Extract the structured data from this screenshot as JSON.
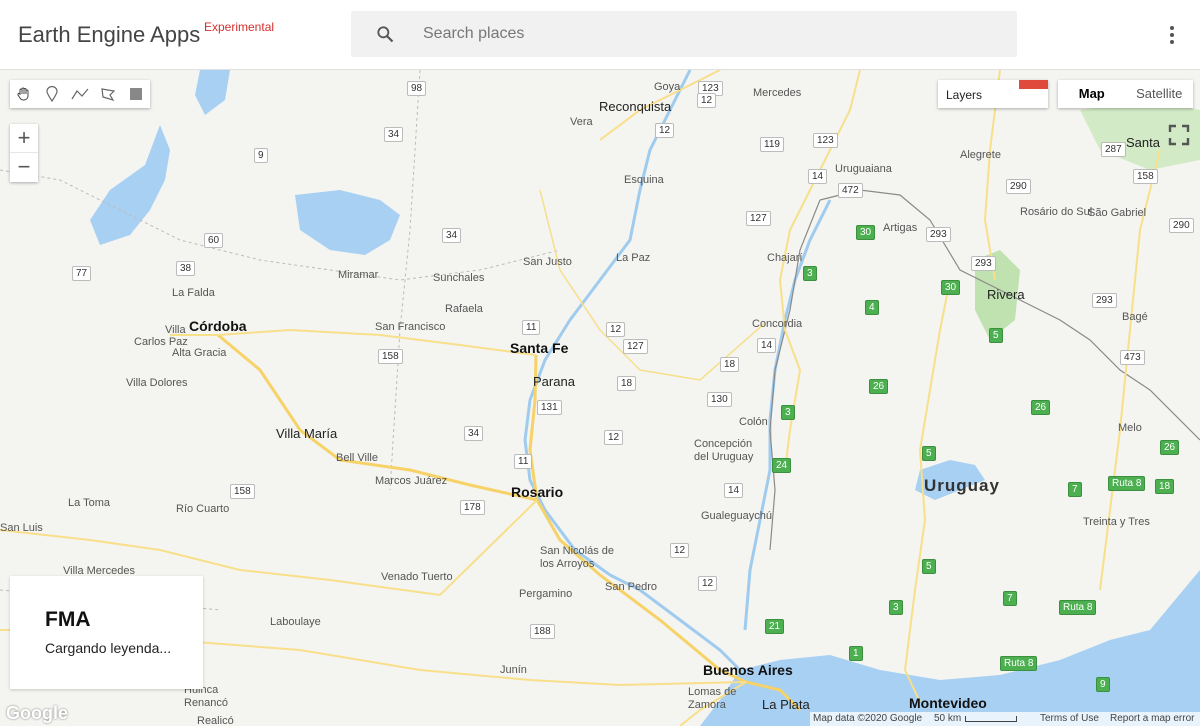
{
  "header": {
    "app_title": "Earth Engine Apps",
    "badge": "Experimental",
    "search_placeholder": "Search places"
  },
  "controls": {
    "zoom_in": "+",
    "zoom_out": "−",
    "layers_label": "Layers",
    "map_type": [
      "Map",
      "Satellite"
    ],
    "map_type_selected": "Map",
    "draw_tools": [
      "hand-icon",
      "point-icon",
      "line-icon",
      "polygon-icon",
      "rectangle-icon"
    ]
  },
  "legend": {
    "title": "FMA",
    "status": "Cargando leyenda..."
  },
  "map": {
    "country_label": "Uruguay",
    "big_cities": [
      "Córdoba",
      "Santa Fe",
      "Rosario",
      "Buenos Aires",
      "Montevideo"
    ],
    "cities": [
      "Reconquista",
      "Goya",
      "Mercedes",
      "Uruguaiana",
      "Alegrete",
      "Santa",
      "Vera",
      "Esquina",
      "Artigas",
      "Rosário do Sul",
      "São Gabriel",
      "Miramar",
      "Sunchales",
      "San Justo",
      "La Paz",
      "Chajarí",
      "Rivera",
      "Rafaela",
      "Concordia",
      "Bagé",
      "La Falda",
      "Villa",
      "Carlos Paz",
      "Alta Gracia",
      "San Francisco",
      "Parana",
      "Villa Dolores",
      "Villa María",
      "Bell Ville",
      "Colón",
      "Concepción del Uruguay",
      "Melo",
      "Marcos Juárez",
      "Gualeguaychú",
      "La Toma",
      "Río Cuarto",
      "San Luis",
      "Villa Mercedes",
      "San Nicolás de los Arroyos",
      "Treinta y Tres",
      "Venado Tuerto",
      "Pergamino",
      "San Pedro",
      "Laboulaye",
      "Junín",
      "Lomas de Zamora",
      "La Plata",
      "Huinca Renancó",
      "Realicó"
    ],
    "attribution": "Map data ©2020 Google",
    "scale": "50 km",
    "terms": "Terms of Use",
    "report": "Report a map error",
    "google": "Google"
  }
}
